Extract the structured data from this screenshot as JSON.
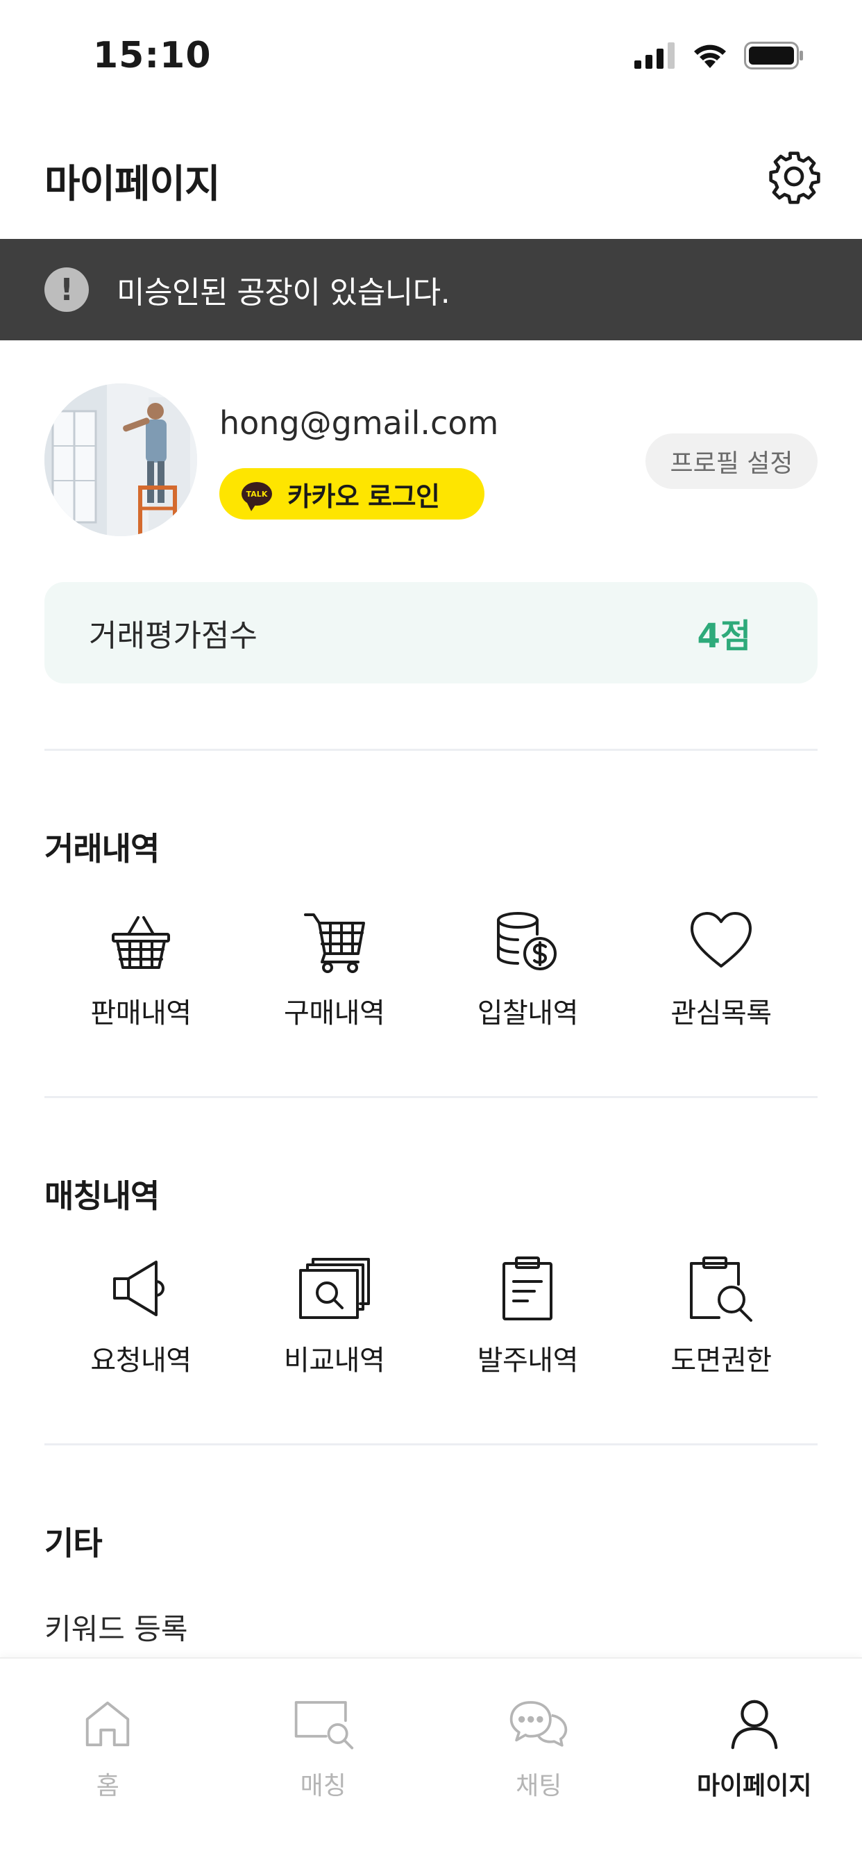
{
  "status_bar": {
    "time": "15:10"
  },
  "header": {
    "title": "마이페이지",
    "settings_icon": "gear-icon"
  },
  "alert": {
    "icon": "exclamation-icon",
    "text": "미승인된 공장이 있습니다."
  },
  "profile": {
    "email": "hong@gmail.com",
    "kakao_badge": "TALK",
    "kakao_login_label": "카카오 로그인",
    "profile_setting_label": "프로필 설정"
  },
  "rating": {
    "label": "거래평가점수",
    "value": "4점",
    "value_color": "#2eaa7a"
  },
  "sections": {
    "trade": {
      "title": "거래내역",
      "items": [
        {
          "label": "판매내역",
          "icon": "basket-icon"
        },
        {
          "label": "구매내역",
          "icon": "cart-icon"
        },
        {
          "label": "입찰내역",
          "icon": "coins-icon"
        },
        {
          "label": "관심목록",
          "icon": "heart-icon"
        }
      ]
    },
    "matching": {
      "title": "매칭내역",
      "items": [
        {
          "label": "요청내역",
          "icon": "megaphone-icon"
        },
        {
          "label": "비교내역",
          "icon": "compare-search-icon"
        },
        {
          "label": "발주내역",
          "icon": "clipboard-icon"
        },
        {
          "label": "도면권한",
          "icon": "clipboard-search-icon"
        }
      ]
    },
    "etc": {
      "title": "기타",
      "items": [
        {
          "label": "키워드 등록"
        }
      ]
    }
  },
  "tabbar": {
    "tabs": [
      {
        "label": "홈",
        "icon": "home-icon",
        "active": false
      },
      {
        "label": "매칭",
        "icon": "matching-icon",
        "active": false
      },
      {
        "label": "채팅",
        "icon": "chat-icon",
        "active": false
      },
      {
        "label": "마이페이지",
        "icon": "user-icon",
        "active": true
      }
    ]
  },
  "colors": {
    "accent": "#2eaa7a",
    "kakao": "#fee500",
    "banner": "#3f3f3f"
  }
}
